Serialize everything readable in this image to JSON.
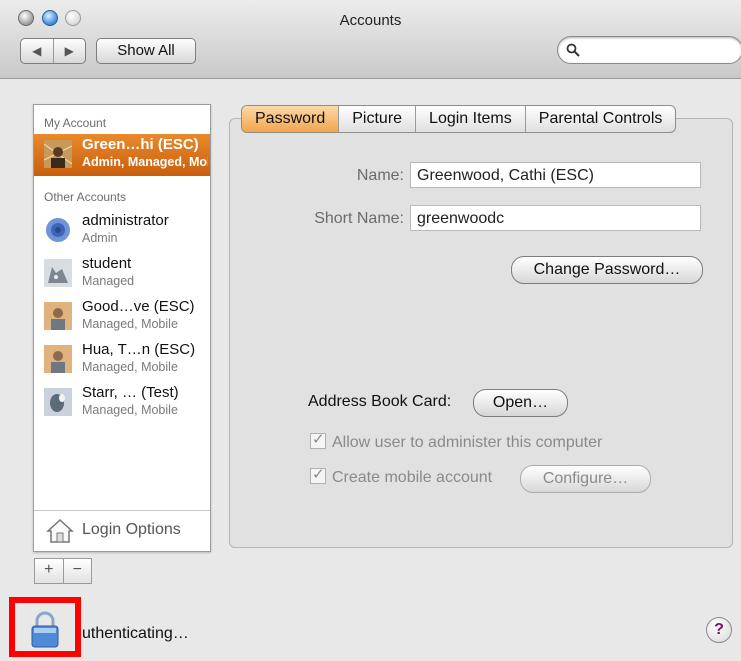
{
  "window": {
    "title": "Accounts"
  },
  "toolbar": {
    "back": "◀",
    "forward": "▶",
    "show_all": "Show All",
    "search_placeholder": ""
  },
  "sidebar": {
    "my_account_header": "My Account",
    "other_accounts_header": "Other Accounts",
    "my_account": {
      "name": "Green…hi (ESC)",
      "role": "Admin, Managed, Mobile"
    },
    "accounts": [
      {
        "name": "administrator",
        "role": "Admin"
      },
      {
        "name": "student",
        "role": "Managed"
      },
      {
        "name": "Good…ve (ESC)",
        "role": "Managed, Mobile"
      },
      {
        "name": "Hua, T…n (ESC)",
        "role": "Managed, Mobile"
      },
      {
        "name": "Starr, … (Test)",
        "role": "Managed, Mobile"
      }
    ],
    "login_options": "Login Options",
    "add": "+",
    "remove": "−"
  },
  "tabs": [
    "Password",
    "Picture",
    "Login Items",
    "Parental Controls"
  ],
  "form": {
    "name_label": "Name:",
    "name_value": "Greenwood, Cathi (ESC)",
    "short_name_label": "Short Name:",
    "short_name_value": "greenwoodc",
    "change_password": "Change Password…",
    "address_book_label": "Address Book Card:",
    "open": "Open…",
    "allow_admin": "Allow user to administer this computer",
    "mobile_account": "Create mobile account",
    "configure": "Configure…"
  },
  "footer": {
    "auth_text": "uthenticating…",
    "help": "?"
  },
  "colors": {
    "selection": "#d86f1a",
    "tab_active": "#f3a54b",
    "highlight_box": "#ff0000"
  }
}
